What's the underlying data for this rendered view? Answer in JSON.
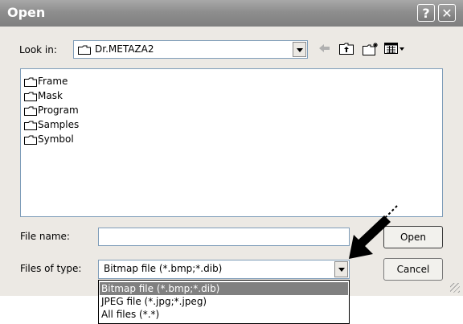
{
  "window": {
    "title": "Open",
    "help_button": "?",
    "close_button": "✕"
  },
  "lookin": {
    "label": "Look in:",
    "value": "Dr.METAZA2"
  },
  "files": [
    {
      "name": "Frame"
    },
    {
      "name": "Mask"
    },
    {
      "name": "Program"
    },
    {
      "name": "Samples"
    },
    {
      "name": "Symbol"
    }
  ],
  "filename": {
    "label": "File name:",
    "value": ""
  },
  "filetype": {
    "label": "Files of type:",
    "value": "Bitmap file (*.bmp;*.dib)",
    "options": [
      "Bitmap file (*.bmp;*.dib)",
      "JPEG file (*.jpg;*.jpeg)",
      "All files (*.*)"
    ]
  },
  "buttons": {
    "open": "Open",
    "cancel": "Cancel"
  },
  "toolbar_icons": [
    "back-arrow-icon",
    "up-folder-icon",
    "new-folder-icon",
    "view-menu-icon"
  ],
  "colors": {
    "titlebar": "#8e8e8e",
    "dialog_bg": "#ece9e4",
    "selection": "#808080"
  }
}
